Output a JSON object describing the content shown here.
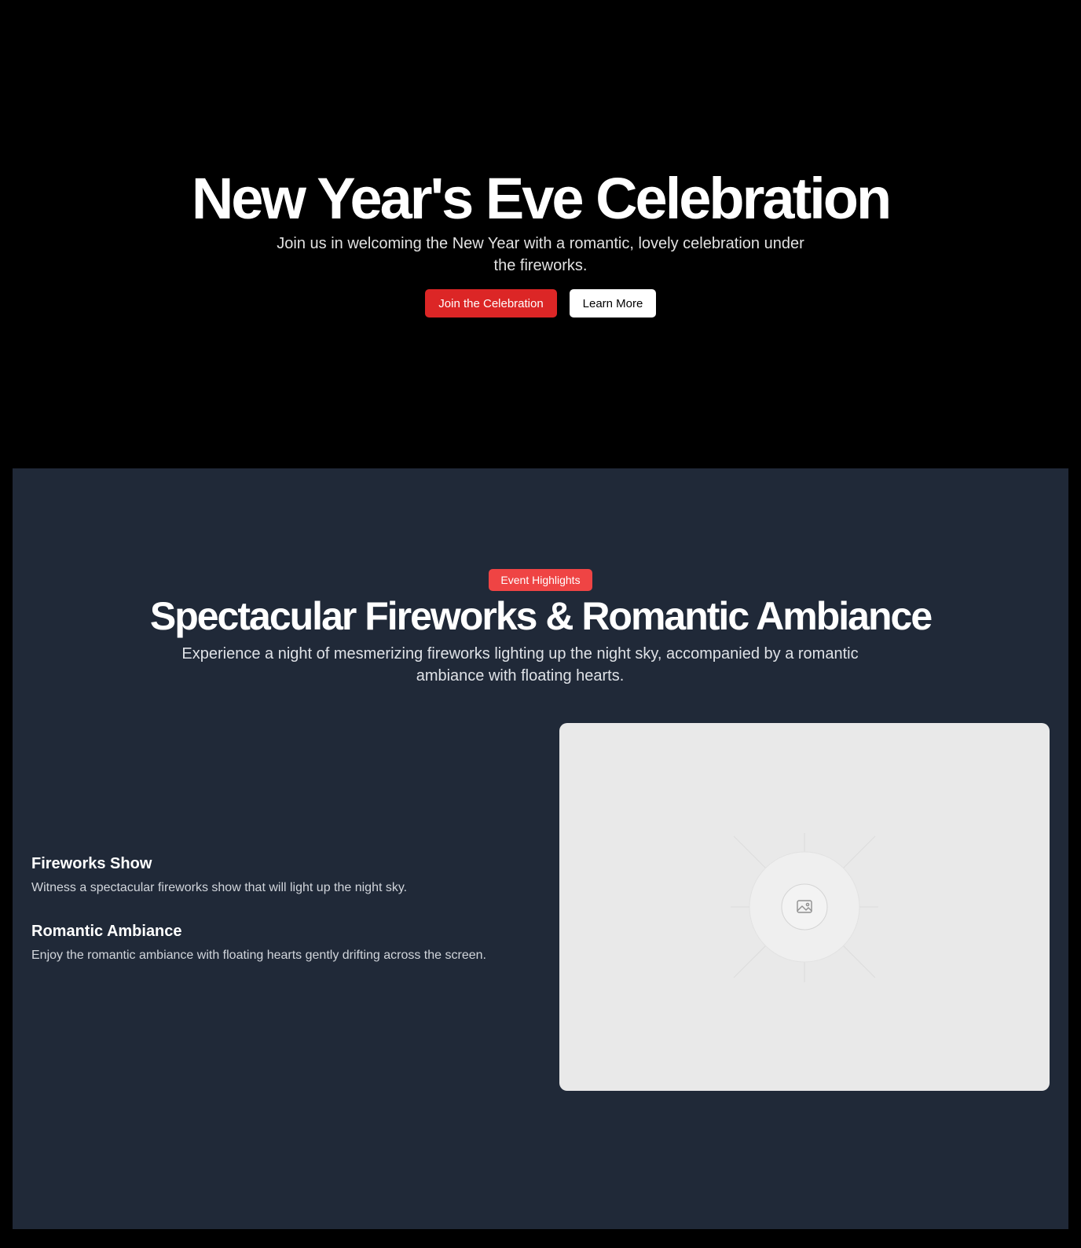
{
  "hero": {
    "title": "New Year's Eve Celebration",
    "subtitle": "Join us in welcoming the New Year with a romantic, lovely celebration under the fireworks.",
    "primary_button": "Join the Celebration",
    "secondary_button": "Learn More"
  },
  "highlights": {
    "badge": "Event Highlights",
    "title": "Spectacular Fireworks & Romantic Ambiance",
    "subtitle": "Experience a night of mesmerizing fireworks lighting up the night sky, accompanied by a romantic ambiance with floating hearts.",
    "features": [
      {
        "title": "Fireworks Show",
        "description": "Witness a spectacular fireworks show that will light up the night sky."
      },
      {
        "title": "Romantic Ambiance",
        "description": "Enjoy the romantic ambiance with floating hearts gently drifting across the screen."
      }
    ],
    "image_icon": "image-placeholder-icon"
  },
  "colors": {
    "hero_background": "#000000",
    "section_background": "#202938",
    "primary_button": "#dc2626",
    "badge": "#ef4444",
    "image_placeholder": "#e9e9e9"
  }
}
